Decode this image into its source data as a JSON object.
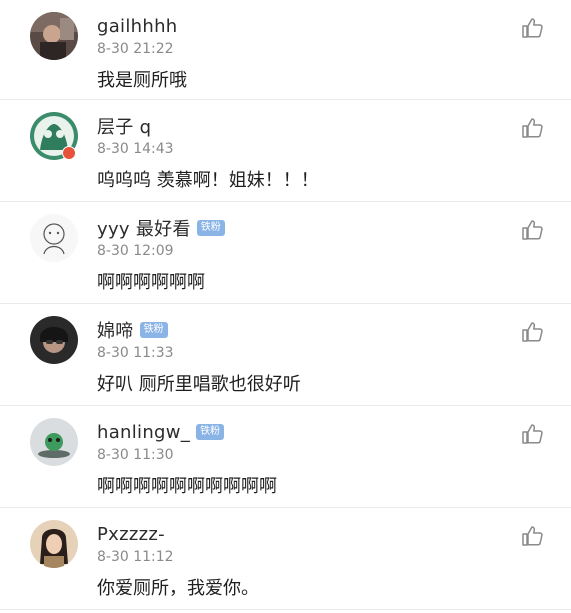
{
  "icons": {
    "like": "thumbs-up-icon",
    "badge": "fan-badge"
  },
  "colors": {
    "badge_bg": "#8bb4e6",
    "timestamp": "#8a8a8a",
    "divider": "#ebebeb"
  },
  "comments": [
    {
      "username": "gailhhhh",
      "badge": "",
      "time": "8-30 21:22",
      "text": "我是厕所哦"
    },
    {
      "username": "层子 q",
      "badge": "",
      "time": "8-30 14:43",
      "text": "呜呜呜 羡慕啊！姐妹！！！"
    },
    {
      "username": "yyy 最好看",
      "badge": "铁粉",
      "time": "8-30 12:09",
      "text": "啊啊啊啊啊啊"
    },
    {
      "username": "婂啼",
      "badge": "铁粉",
      "time": "8-30 11:33",
      "text": "好叭 厕所里唱歌也很好听"
    },
    {
      "username": "hanlingw_",
      "badge": "铁粉",
      "time": "8-30 11:30",
      "text": "啊啊啊啊啊啊啊啊啊啊"
    },
    {
      "username": "Pxzzzz-",
      "badge": "",
      "time": "8-30 11:12",
      "text": "你爱厕所，我爱你。"
    }
  ]
}
